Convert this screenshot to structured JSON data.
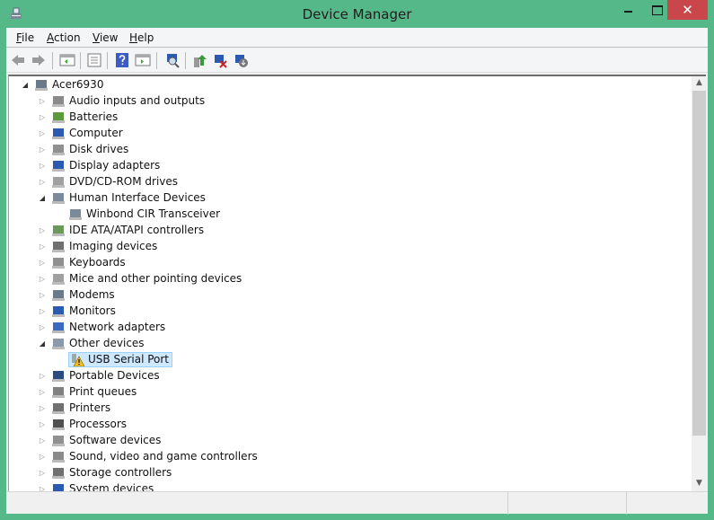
{
  "window": {
    "title": "Device Manager",
    "close_glyph": "✕"
  },
  "menu": [
    {
      "label": "File",
      "key": "F",
      "rest": "ile"
    },
    {
      "label": "Action",
      "key": "A",
      "rest": "ction"
    },
    {
      "label": "View",
      "key": "V",
      "rest": "iew"
    },
    {
      "label": "Help",
      "key": "H",
      "rest": "elp"
    }
  ],
  "toolbar": [
    "back-icon",
    "forward-icon",
    "show-hide-console-tree-icon",
    "properties-icon",
    "help-icon",
    "show-action-pane-icon",
    "scan-hardware-icon",
    "update-driver-icon",
    "uninstall-device-icon",
    "disable-device-icon"
  ],
  "tree": [
    {
      "label": "Acer6930",
      "level": 0,
      "state": "expanded",
      "icon": "computer-icon",
      "color": "#6a7a8a"
    },
    {
      "label": "Audio inputs and outputs",
      "level": 1,
      "state": "collapsed",
      "icon": "speaker-icon",
      "color": "#8a8a8a"
    },
    {
      "label": "Batteries",
      "level": 1,
      "state": "collapsed",
      "icon": "battery-icon",
      "color": "#5a9a3a"
    },
    {
      "label": "Computer",
      "level": 1,
      "state": "collapsed",
      "icon": "monitor-icon",
      "color": "#2a5bb0"
    },
    {
      "label": "Disk drives",
      "level": 1,
      "state": "collapsed",
      "icon": "disk-icon",
      "color": "#909090"
    },
    {
      "label": "Display adapters",
      "level": 1,
      "state": "collapsed",
      "icon": "display-adapter-icon",
      "color": "#2a5bb0"
    },
    {
      "label": "DVD/CD-ROM drives",
      "level": 1,
      "state": "collapsed",
      "icon": "dvd-icon",
      "color": "#a0a0a0"
    },
    {
      "label": "Human Interface Devices",
      "level": 1,
      "state": "expanded",
      "icon": "hid-icon",
      "color": "#7a8a9a"
    },
    {
      "label": "Winbond CIR Transceiver",
      "level": 2,
      "state": "none",
      "icon": "hid-device-icon",
      "color": "#7a8a9a"
    },
    {
      "label": "IDE ATA/ATAPI controllers",
      "level": 1,
      "state": "collapsed",
      "icon": "ide-icon",
      "color": "#6a9a5a"
    },
    {
      "label": "Imaging devices",
      "level": 1,
      "state": "collapsed",
      "icon": "camera-icon",
      "color": "#707070"
    },
    {
      "label": "Keyboards",
      "level": 1,
      "state": "collapsed",
      "icon": "keyboard-icon",
      "color": "#909090"
    },
    {
      "label": "Mice and other pointing devices",
      "level": 1,
      "state": "collapsed",
      "icon": "mouse-icon",
      "color": "#a0a0a0"
    },
    {
      "label": "Modems",
      "level": 1,
      "state": "collapsed",
      "icon": "modem-icon",
      "color": "#6a7a8a"
    },
    {
      "label": "Monitors",
      "level": 1,
      "state": "collapsed",
      "icon": "monitor-icon",
      "color": "#2a5bb0"
    },
    {
      "label": "Network adapters",
      "level": 1,
      "state": "collapsed",
      "icon": "network-icon",
      "color": "#3a6ac0"
    },
    {
      "label": "Other devices",
      "level": 1,
      "state": "expanded",
      "icon": "unknown-device-icon",
      "color": "#8a9aaa"
    },
    {
      "label": "USB Serial Port",
      "level": 2,
      "state": "none",
      "icon": "warning-device-icon",
      "color": "#e0b020",
      "selected": true
    },
    {
      "label": "Portable Devices",
      "level": 1,
      "state": "collapsed",
      "icon": "portable-device-icon",
      "color": "#2a4a80"
    },
    {
      "label": "Print queues",
      "level": 1,
      "state": "collapsed",
      "icon": "printer-icon",
      "color": "#808080"
    },
    {
      "label": "Printers",
      "level": 1,
      "state": "collapsed",
      "icon": "printer-icon",
      "color": "#707070"
    },
    {
      "label": "Processors",
      "level": 1,
      "state": "collapsed",
      "icon": "processor-icon",
      "color": "#505050"
    },
    {
      "label": "Software devices",
      "level": 1,
      "state": "collapsed",
      "icon": "software-device-icon",
      "color": "#909090"
    },
    {
      "label": "Sound, video and game controllers",
      "level": 1,
      "state": "collapsed",
      "icon": "speaker-icon",
      "color": "#8a8a8a"
    },
    {
      "label": "Storage controllers",
      "level": 1,
      "state": "collapsed",
      "icon": "storage-icon",
      "color": "#707070"
    },
    {
      "label": "System devices",
      "level": 1,
      "state": "collapsed",
      "icon": "system-icon",
      "color": "#2a5bb0"
    }
  ],
  "scrollbar": {
    "position_fraction": 0.0,
    "visible_fraction": 0.83
  }
}
